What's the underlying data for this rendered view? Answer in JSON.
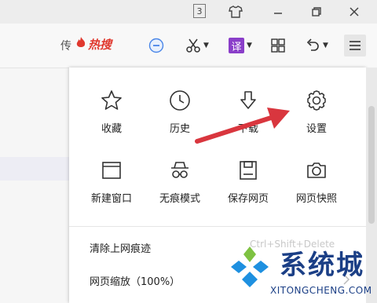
{
  "titlebar": {
    "tab_count": "3",
    "icons": [
      "tab-count-icon",
      "shirt-icon",
      "minimize-icon",
      "restore-icon",
      "close-icon"
    ]
  },
  "toolbar": {
    "hot_prefix": "传",
    "hot_search_label": "热搜",
    "translate_label": "译"
  },
  "menu": {
    "grid": [
      {
        "label": "收藏",
        "icon": "star-icon"
      },
      {
        "label": "历史",
        "icon": "clock-icon"
      },
      {
        "label": "下载",
        "icon": "download-icon"
      },
      {
        "label": "设置",
        "icon": "gear-icon"
      },
      {
        "label": "新建窗口",
        "icon": "window-icon"
      },
      {
        "label": "无痕模式",
        "icon": "incognito-icon"
      },
      {
        "label": "保存网页",
        "icon": "save-icon"
      },
      {
        "label": "网页快照",
        "icon": "camera-icon"
      }
    ],
    "clear_history_label": "清除上网痕迹",
    "clear_history_shortcut": "Ctrl+Shift+Delete",
    "zoom_label": "网页缩放（100%）"
  },
  "watermark": {
    "title": "系统城",
    "url": "XITONGCHENG.COM"
  },
  "colors": {
    "accent_red": "#e0382e",
    "annotation_arrow": "#d9363e",
    "translate_purple": "#8a3ec9",
    "minus_blue": "#4a86e8",
    "watermark_blue": "#1b3f86"
  }
}
